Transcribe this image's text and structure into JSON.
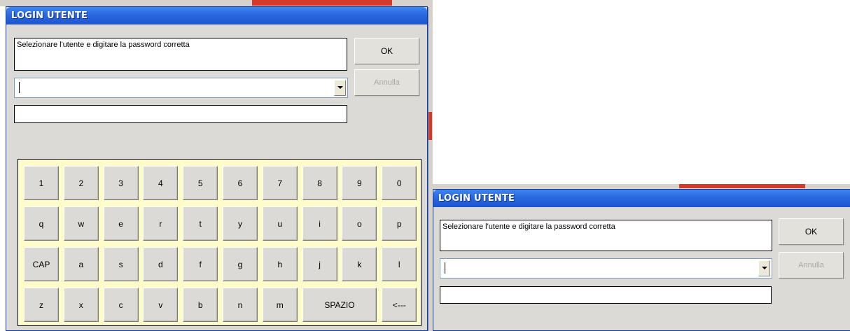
{
  "dialog_main": {
    "title": "LOGIN UTENTE",
    "message": "Selezionare l'utente e digitare la password corretta",
    "user_combo_value": "",
    "password_value": "",
    "ok_label": "OK",
    "cancel_label": "Annulla",
    "keyboard": [
      [
        "1",
        "2",
        "3",
        "4",
        "5",
        "6",
        "7",
        "8",
        "9",
        "0"
      ],
      [
        "q",
        "w",
        "e",
        "r",
        "t",
        "y",
        "u",
        "i",
        "o",
        "p"
      ],
      [
        "CAP",
        "a",
        "s",
        "d",
        "f",
        "g",
        "h",
        "j",
        "k",
        "l"
      ],
      [
        "z",
        "x",
        "c",
        "v",
        "b",
        "n",
        "m",
        "SPAZIO",
        "<---"
      ]
    ]
  },
  "dialog_second": {
    "title": "LOGIN UTENTE",
    "message": "Selezionare l'utente e digitare la password corretta",
    "user_combo_value": "",
    "password_value": "",
    "ok_label": "OK",
    "cancel_label": "Annulla"
  },
  "colors": {
    "titlebar": "#2a68e0",
    "window_bg": "#dcdad6",
    "keyboard_bg": "#fffccc",
    "background_red": "#d33a2c"
  }
}
